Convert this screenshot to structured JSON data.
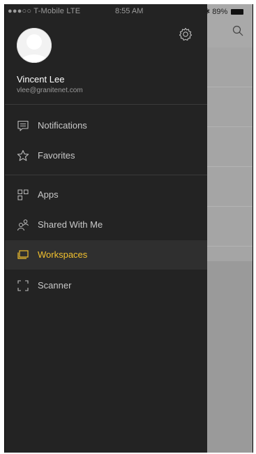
{
  "status_bar": {
    "carrier": "●●●○○ T-Mobile  LTE",
    "time": "8:55 AM",
    "battery": "89%"
  },
  "user": {
    "name": "Vincent Lee",
    "email": "vlee@granitenet.com"
  },
  "menu": {
    "notifications": "Notifications",
    "favorites": "Favorites",
    "apps": "Apps",
    "shared_with_me": "Shared With Me",
    "workspaces": "Workspaces",
    "scanner": "Scanner"
  },
  "active_item": "Workspaces",
  "colors": {
    "drawer_bg": "#232323",
    "accent": "#f2c12e",
    "text": "#c9c9c9"
  },
  "icons": [
    "settings-icon",
    "search-icon",
    "notifications-icon",
    "star-icon",
    "apps-icon",
    "shared-icon",
    "workspaces-icon",
    "scanner-icon"
  ]
}
